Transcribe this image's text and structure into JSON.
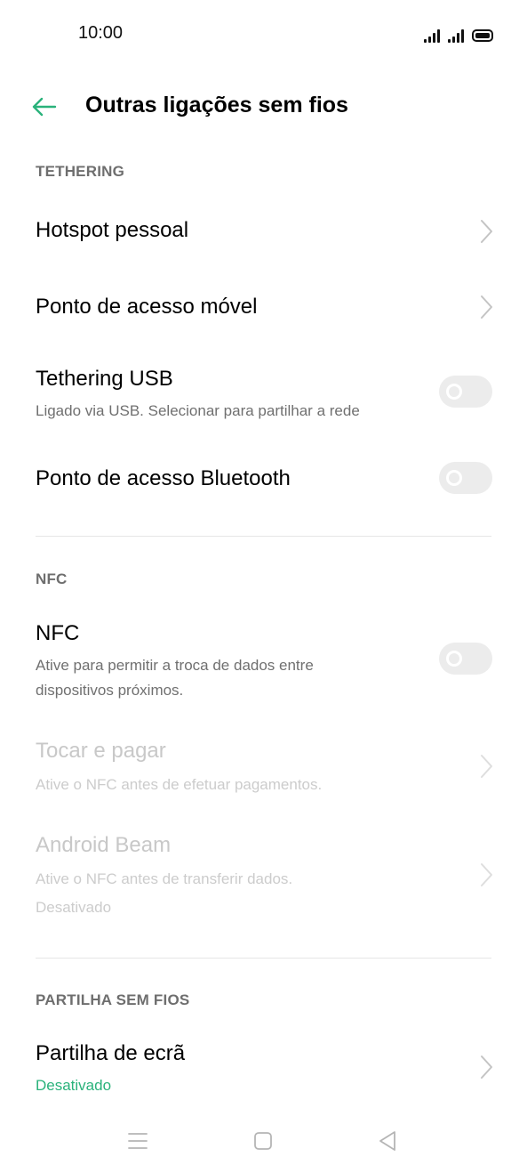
{
  "status_bar": {
    "time": "10:00"
  },
  "header": {
    "title": "Outras ligações sem fios",
    "back_icon": "arrow-left-icon"
  },
  "colors": {
    "accent": "#2ab27b",
    "toggle_off_track": "#ececec",
    "section_header": "#6e6e6e",
    "subtitle": "#707070",
    "disabled_text": "#c8c8c8"
  },
  "sections": {
    "tethering": {
      "header": "TETHERING",
      "hotspot_pessoal": {
        "title": "Hotspot pessoal"
      },
      "ponto_acesso_movel": {
        "title": "Ponto de acesso móvel"
      },
      "tethering_usb": {
        "title": "Tethering USB",
        "subtitle": "Ligado via USB. Selecionar para partilhar a rede",
        "enabled": false
      },
      "ponto_acesso_bluetooth": {
        "title": "Ponto de acesso Bluetooth",
        "enabled": false
      }
    },
    "nfc": {
      "header": "NFC",
      "nfc": {
        "title": "NFC",
        "subtitle_line1": "Ative para permitir a troca de dados entre",
        "subtitle_line2": "dispositivos próximos.",
        "enabled": false
      },
      "tocar_e_pagar": {
        "title": "Tocar e pagar",
        "subtitle": "Ative o NFC antes de efetuar pagamentos."
      },
      "android_beam": {
        "title": "Android Beam",
        "subtitle_line1": "Ative o NFC antes de transferir dados.",
        "subtitle_line2": "Desativado"
      }
    },
    "partilha": {
      "header": "PARTILHA SEM FIOS",
      "partilha_de_ecra": {
        "title": "Partilha de ecrã",
        "subtitle": "Desativado"
      }
    }
  },
  "nav_bar": {
    "icons": [
      "menu-icon",
      "home-square-icon",
      "back-triangle-icon"
    ]
  }
}
